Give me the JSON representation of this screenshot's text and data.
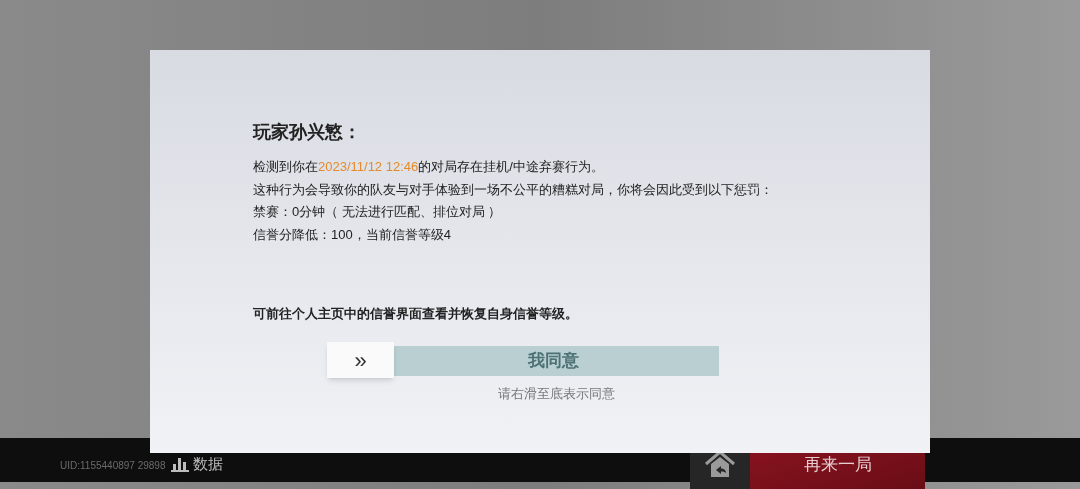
{
  "dialog": {
    "title": "玩家孙兴慜：",
    "paragraphs": [
      {
        "parts": [
          {
            "text": "检测到你在",
            "highlight": false
          },
          {
            "text": "2023/11/12  12:46",
            "highlight": true
          },
          {
            "text": "的对局存在挂机/中途弃赛行为。",
            "highlight": false
          }
        ]
      },
      {
        "parts": [
          {
            "text": "这种行为会导致你的队友与对手体验到一场不公平的糟糕对局，你将会因此受到以下惩罚：",
            "highlight": false
          }
        ]
      },
      {
        "parts": [
          {
            "text": "禁赛：0分钟（ 无法进行匹配、排位对局 ）",
            "highlight": false
          }
        ]
      },
      {
        "parts": [
          {
            "text": "信誉分降低：100，当前信誉等级4",
            "highlight": false
          }
        ]
      }
    ],
    "note": "可前往个人主页中的信誉界面查看并恢复自身信誉等级。",
    "slider": {
      "handle": "»",
      "label": "我同意",
      "level": 0,
      "hint": "请右滑至底表示同意"
    }
  },
  "bottom_bar": {
    "uid": "UID:1155440897 29898",
    "data_button": "数据",
    "replay_button": "再来一局"
  }
}
